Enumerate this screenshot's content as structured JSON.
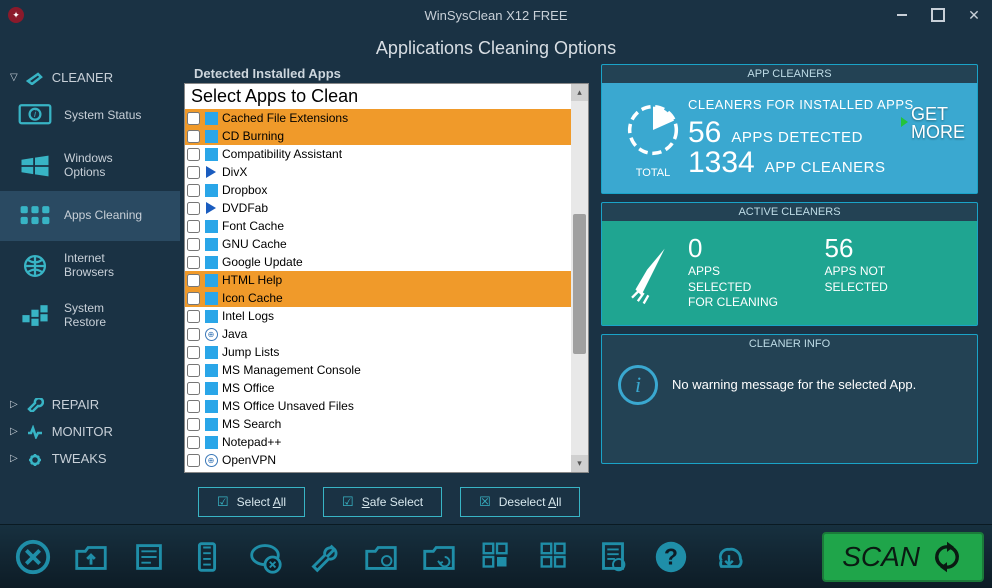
{
  "window": {
    "title": "WinSysClean X12 FREE",
    "subtitle": "Applications Cleaning Options"
  },
  "sidebar": {
    "categories": [
      {
        "label": "CLEANER",
        "expanded": true
      },
      {
        "label": "REPAIR",
        "expanded": false
      },
      {
        "label": "MONITOR",
        "expanded": false
      },
      {
        "label": "TWEAKS",
        "expanded": false
      }
    ],
    "items": [
      {
        "label": "System Status",
        "active": false
      },
      {
        "label": "Windows\nOptions",
        "active": false
      },
      {
        "label": "Apps Cleaning",
        "active": true
      },
      {
        "label": "Internet\nBrowsers",
        "active": false
      },
      {
        "label": "System\nRestore",
        "active": false
      }
    ]
  },
  "apps": {
    "header": "Detected Installed Apps",
    "listTitle": "Select Apps to Clean",
    "items": [
      {
        "name": "Cached File Extensions",
        "icon": "win",
        "highlighted": true
      },
      {
        "name": "CD Burning",
        "icon": "win",
        "highlighted": true
      },
      {
        "name": "Compatibility Assistant",
        "icon": "win",
        "highlighted": false
      },
      {
        "name": "DivX",
        "icon": "play",
        "highlighted": false
      },
      {
        "name": "Dropbox",
        "icon": "win",
        "highlighted": false
      },
      {
        "name": "DVDFab",
        "icon": "play",
        "highlighted": false
      },
      {
        "name": "Font Cache",
        "icon": "win",
        "highlighted": false
      },
      {
        "name": "GNU Cache",
        "icon": "win",
        "highlighted": false
      },
      {
        "name": "Google Update",
        "icon": "win",
        "highlighted": false
      },
      {
        "name": "HTML Help",
        "icon": "win",
        "highlighted": true
      },
      {
        "name": "Icon Cache",
        "icon": "win",
        "highlighted": true
      },
      {
        "name": "Intel Logs",
        "icon": "win",
        "highlighted": false
      },
      {
        "name": "Java",
        "icon": "globe",
        "highlighted": false
      },
      {
        "name": "Jump Lists",
        "icon": "win",
        "highlighted": false
      },
      {
        "name": "MS Management Console",
        "icon": "win",
        "highlighted": false
      },
      {
        "name": "MS Office",
        "icon": "win",
        "highlighted": false
      },
      {
        "name": "MS Office Unsaved Files",
        "icon": "win",
        "highlighted": false
      },
      {
        "name": "MS Search",
        "icon": "win",
        "highlighted": false
      },
      {
        "name": "Notepad++",
        "icon": "win",
        "highlighted": false
      },
      {
        "name": "OpenVPN",
        "icon": "globe",
        "highlighted": false
      }
    ],
    "buttons": {
      "selectAll": "Select All",
      "safeSelect": "Safe Select",
      "deselectAll": "Deselect All"
    }
  },
  "cards": {
    "appCleaners": {
      "title": "APP CLEANERS",
      "subtitle": "CLEANERS FOR INSTALLED APPS",
      "detected": 56,
      "detectedLabel": "APPS DETECTED",
      "cleaners": 1334,
      "cleanersLabel": "APP CLEANERS",
      "totalLabel": "TOTAL",
      "getMore": "GET\nMORE"
    },
    "active": {
      "title": "ACTIVE CLEANERS",
      "selected": 0,
      "selectedLabel": "APPS\nSELECTED\nFOR CLEANING",
      "notSelected": 56,
      "notSelectedLabel": "APPS NOT\nSELECTED"
    },
    "info": {
      "title": "CLEANER INFO",
      "message": "No warning message for the selected App."
    }
  },
  "bottom": {
    "scan": "SCAN"
  }
}
